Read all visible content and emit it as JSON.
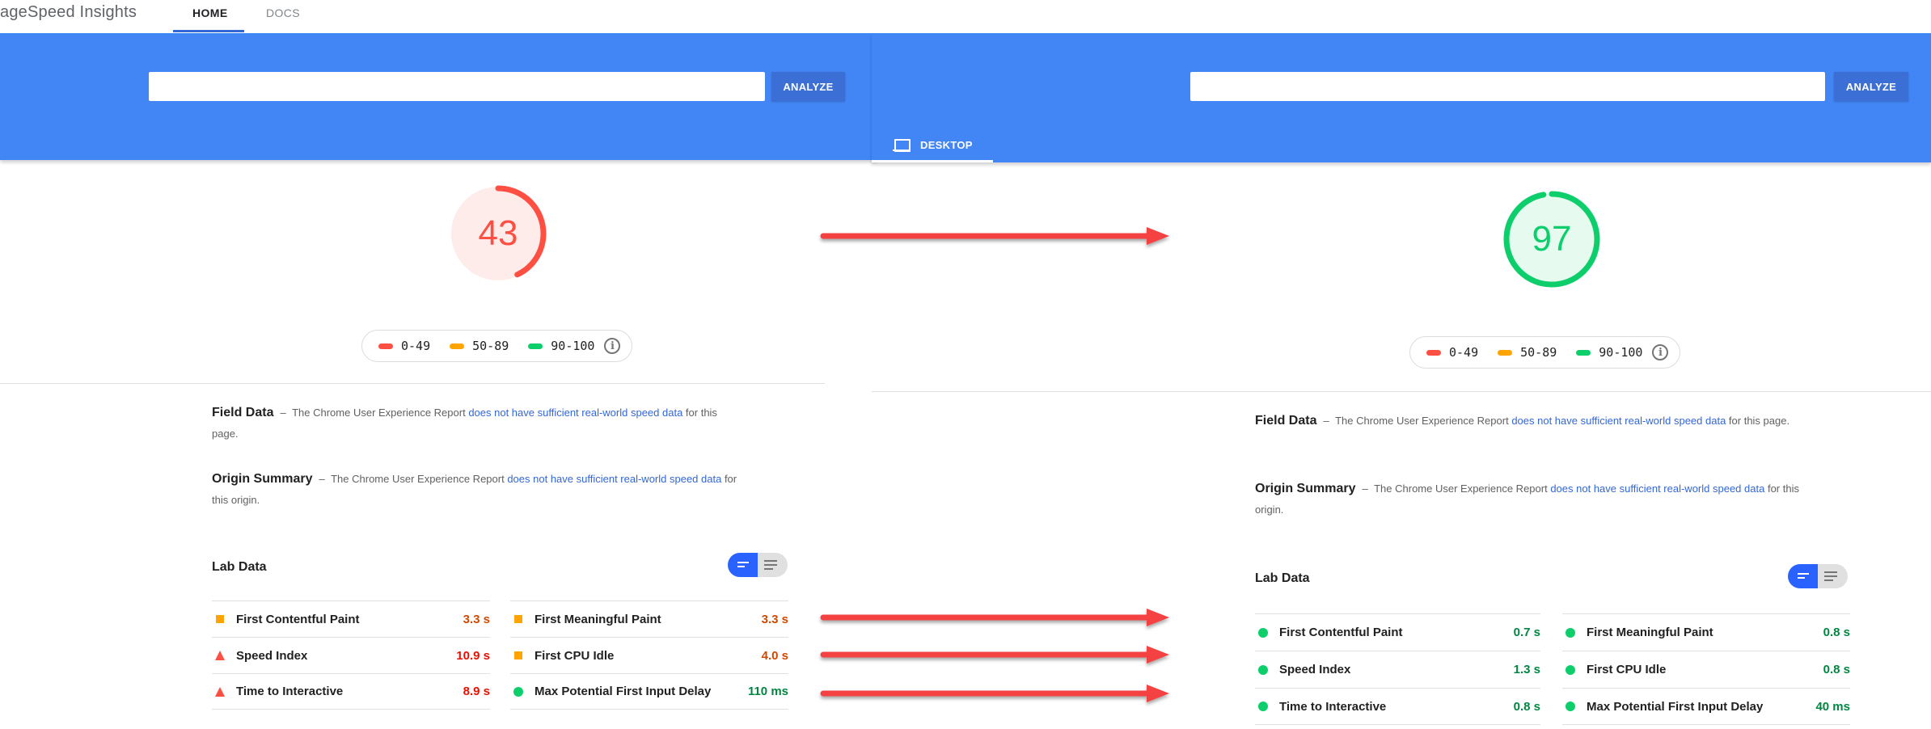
{
  "app": {
    "title": "PageSpeed Insights",
    "title_visible": "ageSpeed Insights",
    "nav_tabs": [
      {
        "label": "HOME",
        "active": true
      },
      {
        "label": "DOCS",
        "active": false
      }
    ]
  },
  "colors": {
    "header_blue": "#4285f4",
    "button_blue": "#3b6fd6",
    "fail": "#ff4e42",
    "average": "#ffa400",
    "pass": "#0cce6b",
    "link": "#3367d6",
    "annotation_arrow": "#f44242"
  },
  "before": {
    "search": {
      "value": "",
      "placeholder": ""
    },
    "analyze_label": "ANALYZE",
    "score": 43,
    "score_color": "#ff4e42",
    "score_bg": "#fdecea",
    "legend": [
      {
        "label": "0-49",
        "color": "#ff4e42"
      },
      {
        "label": "50-89",
        "color": "#ffa400"
      },
      {
        "label": "90-100",
        "color": "#0cce6b"
      }
    ],
    "info_icon": "info-icon",
    "field_data": {
      "label": "Field Data",
      "dash": "–",
      "text_before": "The Chrome User Experience Report",
      "link": "does not have sufficient real-world speed data",
      "text_after": "for this page."
    },
    "origin_summary": {
      "label": "Origin Summary",
      "dash": "–",
      "text_before": "The Chrome User Experience Report",
      "link": "does not have sufficient real-world speed data",
      "text_after": "for this origin."
    },
    "lab_data_title": "Lab Data",
    "metrics_left": [
      {
        "label": "First Contentful Paint",
        "value": "3.3 s",
        "rating": "average"
      },
      {
        "label": "Speed Index",
        "value": "10.9 s",
        "rating": "fail"
      },
      {
        "label": "Time to Interactive",
        "value": "8.9 s",
        "rating": "fail"
      }
    ],
    "metrics_right": [
      {
        "label": "First Meaningful Paint",
        "value": "3.3 s",
        "rating": "average"
      },
      {
        "label": "First CPU Idle",
        "value": "4.0 s",
        "rating": "average"
      },
      {
        "label": "Max Potential First Input Delay",
        "value": "110 ms",
        "rating": "pass"
      }
    ]
  },
  "after": {
    "search": {
      "value": "",
      "placeholder": ""
    },
    "analyze_label": "ANALYZE",
    "device_tab": {
      "label": "DESKTOP",
      "icon": "laptop-icon"
    },
    "score": 97,
    "score_color": "#0cce6b",
    "score_bg": "#e6faf0",
    "legend": [
      {
        "label": "0-49",
        "color": "#ff4e42"
      },
      {
        "label": "50-89",
        "color": "#ffa400"
      },
      {
        "label": "90-100",
        "color": "#0cce6b"
      }
    ],
    "info_icon": "info-icon",
    "field_data": {
      "label": "Field Data",
      "dash": "–",
      "text_before": "The Chrome User Experience Report",
      "link": "does not have sufficient real-world speed data",
      "text_after": "for this page."
    },
    "origin_summary": {
      "label": "Origin Summary",
      "dash": "–",
      "text_before": "The Chrome User Experience Report",
      "link": "does not have sufficient real-world speed",
      "link2": "data",
      "text_after": "for this origin."
    },
    "lab_data_title": "Lab Data",
    "metrics_left": [
      {
        "label": "First Contentful Paint",
        "value": "0.7 s",
        "rating": "pass"
      },
      {
        "label": "Speed Index",
        "value": "1.3 s",
        "rating": "pass"
      },
      {
        "label": "Time to Interactive",
        "value": "0.8 s",
        "rating": "pass"
      }
    ],
    "metrics_right": [
      {
        "label": "First Meaningful Paint",
        "value": "0.8 s",
        "rating": "pass"
      },
      {
        "label": "First CPU Idle",
        "value": "0.8 s",
        "rating": "pass"
      },
      {
        "label": "Max Potential First Input Delay",
        "value": "40 ms",
        "rating": "pass"
      }
    ]
  },
  "annotations": {
    "arrows": [
      {
        "from": "score-before",
        "to": "score-after"
      },
      {
        "from": "metrics-row-1-before",
        "to": "metrics-row-1-after"
      },
      {
        "from": "metrics-row-2-before",
        "to": "metrics-row-2-after"
      },
      {
        "from": "metrics-row-3-before",
        "to": "metrics-row-3-after"
      }
    ]
  }
}
